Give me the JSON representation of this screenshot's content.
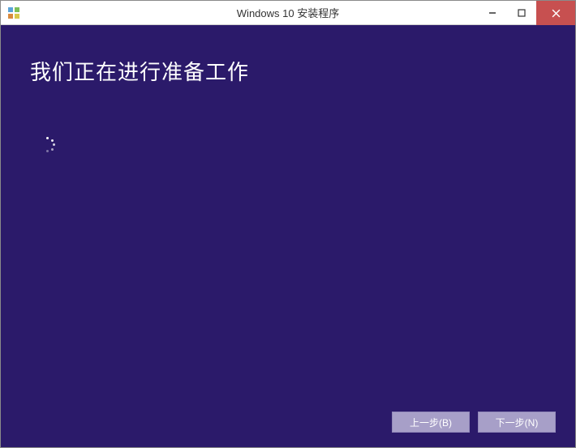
{
  "titlebar": {
    "title": "Windows 10 安装程序"
  },
  "content": {
    "heading": "我们正在进行准备工作"
  },
  "buttons": {
    "back": "上一步(B)",
    "next": "下一步(N)"
  }
}
